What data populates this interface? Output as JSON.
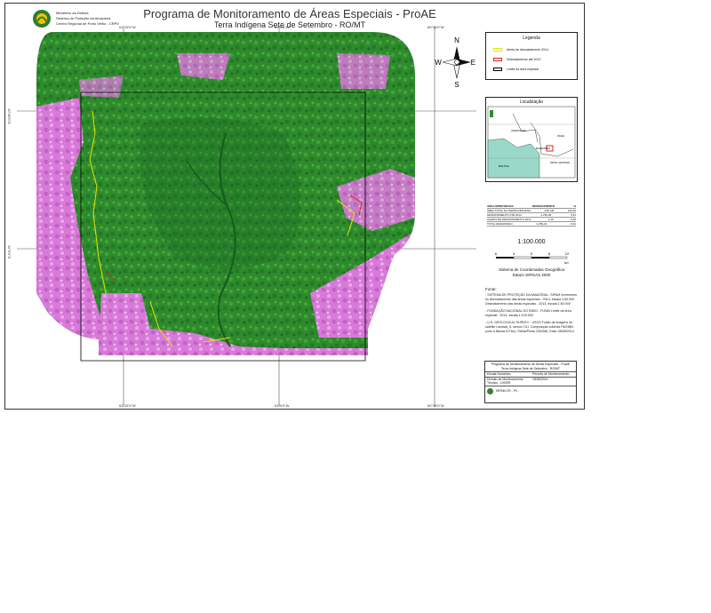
{
  "header": {
    "institution_lines": [
      "Ministério da Defesa",
      "Sistema de Proteção da Amazônia",
      "Centro Regional de Porto Velho - CRPV"
    ],
    "title": "Programa de Monitoramento de Áreas Especiais - ProAE",
    "subtitle": "Terra Indígena Sete de Setembro - RO/MT"
  },
  "map": {
    "north_arrow_label": "N",
    "south_label": "S",
    "east_label": "E",
    "west_label": "W",
    "top_coords": [
      "61°15'0\"W",
      "61°0'0\"W",
      "60°45'0\"W"
    ],
    "bottom_coords": [
      "61°15'0\"W",
      "61°0'0\"W",
      "60°45'0\"W"
    ],
    "left_coords": [
      "10°45'0\"S",
      "11°0'0\"S"
    ],
    "colors": {
      "forest": "#2e8a2c",
      "deforested": "#d77ad8",
      "annual_deforestation": "#e6e600",
      "accumulated_deforestation": "#dd2222",
      "boundary": "#000000"
    }
  },
  "legend": {
    "title": "Legenda",
    "items": [
      {
        "label": "Alerta de desmatamento 2014",
        "color": "#e6e600"
      },
      {
        "label": "Desmatamento até 2013",
        "color": "#dd2222"
      },
      {
        "label": "Limite da área especial",
        "color": "#000000"
      }
    ]
  },
  "location": {
    "title": "Localização",
    "places": [
      "RONDÔNIA",
      "MATO GROSSO",
      "BOLÍVIA",
      "AMAZONAS",
      "PARÁ"
    ]
  },
  "stats_table": {
    "headers": [
      "ÁREA MONITORADA",
      "DESMATAMENTO",
      "%"
    ],
    "rows": [
      [
        "ÁREA TOTAL DA TERRA INDÍGENA",
        "248.146",
        "100,00"
      ],
      [
        "DESMATAMENTO ATÉ 2013",
        "2.256,28",
        "0,91"
      ],
      [
        "ALERTA DE DESMATAMENTO 2014",
        "3,15",
        "0,00"
      ],
      [
        "TOTAL DESMATADO",
        "2.259,43",
        "0,91"
      ]
    ]
  },
  "scale": {
    "ratio": "1:100.000",
    "ticks": [
      "6",
      "3",
      "0",
      "6",
      "12"
    ],
    "unit": "km"
  },
  "srs": {
    "line1": "Sistema de Coordenadas Geográfica",
    "line2": "Datum SIRGAS 2000"
  },
  "sources": {
    "header": "Fonte:",
    "items": [
      "- SISTEMA DE PROTEÇÃO DA AMAZÔNIA - SIPAM Incremento do desmatamento das áreas especiais - 2014, escala 1:50.000 Desmatamento das áreas especiais - 2013, escala 1:50.000",
      "- FUNDAÇÃO NACIONAL DO ÍNDIO - FUNAI Limite da área especial - 2014, escala 1:100.000",
      "- U.S. GEOLOGICAL SURVEY - USGS Fusão de imagens do satélite Landsat_8, sensor OLI. Composição colorida R6G5B4 (com a Banda 8 Pan). Órbita/Ponto 230/068, Data: 08/08/2014"
    ]
  },
  "info_box": {
    "title_line1": "Programa de Monitoramento de Áreas Especiais - ProAE",
    "title_line2": "Terra Indígena Sete de Setembro - RO/MT",
    "row1": [
      "Escala Numérica",
      "Período de Monitoramento"
    ],
    "row2": [
      "Divisão de Monitoramento Técnico - DIGER",
      "18/08/2014"
    ],
    "org": "SIPAM CR - PV"
  }
}
